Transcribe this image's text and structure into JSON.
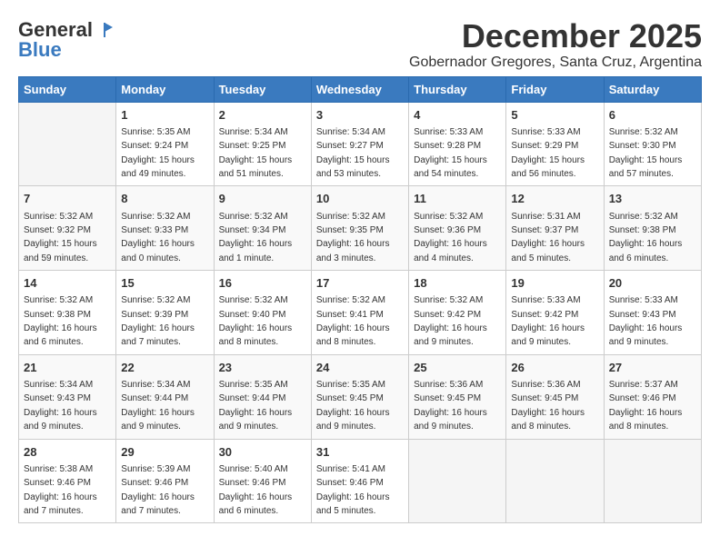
{
  "header": {
    "logo_general": "General",
    "logo_blue": "Blue",
    "month_title": "December 2025",
    "subtitle": "Gobernador Gregores, Santa Cruz, Argentina"
  },
  "days_of_week": [
    "Sunday",
    "Monday",
    "Tuesday",
    "Wednesday",
    "Thursday",
    "Friday",
    "Saturday"
  ],
  "weeks": [
    [
      {
        "day": "",
        "sunrise": "",
        "sunset": "",
        "daylight": "",
        "empty": true
      },
      {
        "day": "1",
        "sunrise": "Sunrise: 5:35 AM",
        "sunset": "Sunset: 9:24 PM",
        "daylight": "Daylight: 15 hours and 49 minutes."
      },
      {
        "day": "2",
        "sunrise": "Sunrise: 5:34 AM",
        "sunset": "Sunset: 9:25 PM",
        "daylight": "Daylight: 15 hours and 51 minutes."
      },
      {
        "day": "3",
        "sunrise": "Sunrise: 5:34 AM",
        "sunset": "Sunset: 9:27 PM",
        "daylight": "Daylight: 15 hours and 53 minutes."
      },
      {
        "day": "4",
        "sunrise": "Sunrise: 5:33 AM",
        "sunset": "Sunset: 9:28 PM",
        "daylight": "Daylight: 15 hours and 54 minutes."
      },
      {
        "day": "5",
        "sunrise": "Sunrise: 5:33 AM",
        "sunset": "Sunset: 9:29 PM",
        "daylight": "Daylight: 15 hours and 56 minutes."
      },
      {
        "day": "6",
        "sunrise": "Sunrise: 5:32 AM",
        "sunset": "Sunset: 9:30 PM",
        "daylight": "Daylight: 15 hours and 57 minutes."
      }
    ],
    [
      {
        "day": "7",
        "sunrise": "Sunrise: 5:32 AM",
        "sunset": "Sunset: 9:32 PM",
        "daylight": "Daylight: 15 hours and 59 minutes."
      },
      {
        "day": "8",
        "sunrise": "Sunrise: 5:32 AM",
        "sunset": "Sunset: 9:33 PM",
        "daylight": "Daylight: 16 hours and 0 minutes."
      },
      {
        "day": "9",
        "sunrise": "Sunrise: 5:32 AM",
        "sunset": "Sunset: 9:34 PM",
        "daylight": "Daylight: 16 hours and 1 minute."
      },
      {
        "day": "10",
        "sunrise": "Sunrise: 5:32 AM",
        "sunset": "Sunset: 9:35 PM",
        "daylight": "Daylight: 16 hours and 3 minutes."
      },
      {
        "day": "11",
        "sunrise": "Sunrise: 5:32 AM",
        "sunset": "Sunset: 9:36 PM",
        "daylight": "Daylight: 16 hours and 4 minutes."
      },
      {
        "day": "12",
        "sunrise": "Sunrise: 5:31 AM",
        "sunset": "Sunset: 9:37 PM",
        "daylight": "Daylight: 16 hours and 5 minutes."
      },
      {
        "day": "13",
        "sunrise": "Sunrise: 5:32 AM",
        "sunset": "Sunset: 9:38 PM",
        "daylight": "Daylight: 16 hours and 6 minutes."
      }
    ],
    [
      {
        "day": "14",
        "sunrise": "Sunrise: 5:32 AM",
        "sunset": "Sunset: 9:38 PM",
        "daylight": "Daylight: 16 hours and 6 minutes."
      },
      {
        "day": "15",
        "sunrise": "Sunrise: 5:32 AM",
        "sunset": "Sunset: 9:39 PM",
        "daylight": "Daylight: 16 hours and 7 minutes."
      },
      {
        "day": "16",
        "sunrise": "Sunrise: 5:32 AM",
        "sunset": "Sunset: 9:40 PM",
        "daylight": "Daylight: 16 hours and 8 minutes."
      },
      {
        "day": "17",
        "sunrise": "Sunrise: 5:32 AM",
        "sunset": "Sunset: 9:41 PM",
        "daylight": "Daylight: 16 hours and 8 minutes."
      },
      {
        "day": "18",
        "sunrise": "Sunrise: 5:32 AM",
        "sunset": "Sunset: 9:42 PM",
        "daylight": "Daylight: 16 hours and 9 minutes."
      },
      {
        "day": "19",
        "sunrise": "Sunrise: 5:33 AM",
        "sunset": "Sunset: 9:42 PM",
        "daylight": "Daylight: 16 hours and 9 minutes."
      },
      {
        "day": "20",
        "sunrise": "Sunrise: 5:33 AM",
        "sunset": "Sunset: 9:43 PM",
        "daylight": "Daylight: 16 hours and 9 minutes."
      }
    ],
    [
      {
        "day": "21",
        "sunrise": "Sunrise: 5:34 AM",
        "sunset": "Sunset: 9:43 PM",
        "daylight": "Daylight: 16 hours and 9 minutes."
      },
      {
        "day": "22",
        "sunrise": "Sunrise: 5:34 AM",
        "sunset": "Sunset: 9:44 PM",
        "daylight": "Daylight: 16 hours and 9 minutes."
      },
      {
        "day": "23",
        "sunrise": "Sunrise: 5:35 AM",
        "sunset": "Sunset: 9:44 PM",
        "daylight": "Daylight: 16 hours and 9 minutes."
      },
      {
        "day": "24",
        "sunrise": "Sunrise: 5:35 AM",
        "sunset": "Sunset: 9:45 PM",
        "daylight": "Daylight: 16 hours and 9 minutes."
      },
      {
        "day": "25",
        "sunrise": "Sunrise: 5:36 AM",
        "sunset": "Sunset: 9:45 PM",
        "daylight": "Daylight: 16 hours and 9 minutes."
      },
      {
        "day": "26",
        "sunrise": "Sunrise: 5:36 AM",
        "sunset": "Sunset: 9:45 PM",
        "daylight": "Daylight: 16 hours and 8 minutes."
      },
      {
        "day": "27",
        "sunrise": "Sunrise: 5:37 AM",
        "sunset": "Sunset: 9:46 PM",
        "daylight": "Daylight: 16 hours and 8 minutes."
      }
    ],
    [
      {
        "day": "28",
        "sunrise": "Sunrise: 5:38 AM",
        "sunset": "Sunset: 9:46 PM",
        "daylight": "Daylight: 16 hours and 7 minutes."
      },
      {
        "day": "29",
        "sunrise": "Sunrise: 5:39 AM",
        "sunset": "Sunset: 9:46 PM",
        "daylight": "Daylight: 16 hours and 7 minutes."
      },
      {
        "day": "30",
        "sunrise": "Sunrise: 5:40 AM",
        "sunset": "Sunset: 9:46 PM",
        "daylight": "Daylight: 16 hours and 6 minutes."
      },
      {
        "day": "31",
        "sunrise": "Sunrise: 5:41 AM",
        "sunset": "Sunset: 9:46 PM",
        "daylight": "Daylight: 16 hours and 5 minutes."
      },
      {
        "day": "",
        "sunrise": "",
        "sunset": "",
        "daylight": "",
        "empty": true
      },
      {
        "day": "",
        "sunrise": "",
        "sunset": "",
        "daylight": "",
        "empty": true
      },
      {
        "day": "",
        "sunrise": "",
        "sunset": "",
        "daylight": "",
        "empty": true
      }
    ]
  ]
}
